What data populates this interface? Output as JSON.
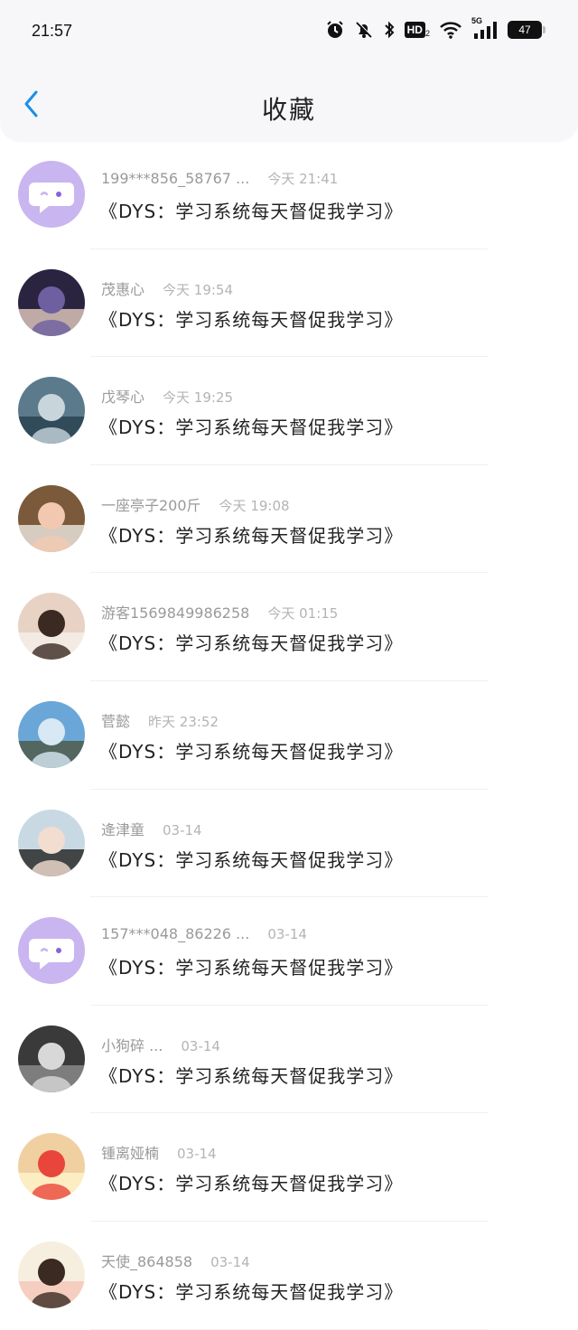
{
  "status_bar": {
    "time": "21:57",
    "battery": "47",
    "icons": [
      "alarm-icon",
      "mute-bell-icon",
      "bluetooth-icon",
      "hd-icon",
      "wifi-icon",
      "5g-signal-icon",
      "battery-icon"
    ],
    "hd_label": "HD",
    "hd_sub": "2",
    "network_label": "5G"
  },
  "header": {
    "title": "收藏",
    "back_icon": "chevron-left-icon"
  },
  "colors": {
    "accent": "#1a8fe8",
    "title": "#222222",
    "meta": "#9a9a9a"
  },
  "favorites": [
    {
      "name": "199***856_58767 ...",
      "time": "今天 21:41",
      "message": "《DYS：学习系统每天督促我学习》",
      "avatar": "default-chat-avatar"
    },
    {
      "name": "茂惠心",
      "time": "今天 19:54",
      "message": "《DYS：学习系统每天督促我学习》",
      "avatar": "photo-avatar"
    },
    {
      "name": "戊琴心",
      "time": "今天 19:25",
      "message": "《DYS：学习系统每天督促我学习》",
      "avatar": "photo-avatar"
    },
    {
      "name": "一座亭子200斤",
      "time": "今天 19:08",
      "message": "《DYS：学习系统每天督促我学习》",
      "avatar": "photo-avatar"
    },
    {
      "name": "游客1569849986258",
      "time": "今天 01:15",
      "message": "《DYS：学习系统每天督促我学习》",
      "avatar": "photo-avatar"
    },
    {
      "name": "菅懿",
      "time": "昨天 23:52",
      "message": "《DYS：学习系统每天督促我学习》",
      "avatar": "photo-avatar"
    },
    {
      "name": "逄津童",
      "time": "03-14",
      "message": "《DYS：学习系统每天督促我学习》",
      "avatar": "photo-avatar"
    },
    {
      "name": "157***048_86226 ...",
      "time": "03-14",
      "message": "《DYS：学习系统每天督促我学习》",
      "avatar": "default-chat-avatar"
    },
    {
      "name": "小狗碎 ...",
      "time": "03-14",
      "message": "《DYS：学习系统每天督促我学习》",
      "avatar": "photo-avatar"
    },
    {
      "name": "锺离娅楠",
      "time": "03-14",
      "message": "《DYS：学习系统每天督促我学习》",
      "avatar": "photo-avatar"
    },
    {
      "name": "天使_864858",
      "time": "03-14",
      "message": "《DYS：学习系统每天督促我学习》",
      "avatar": "photo-avatar"
    }
  ]
}
